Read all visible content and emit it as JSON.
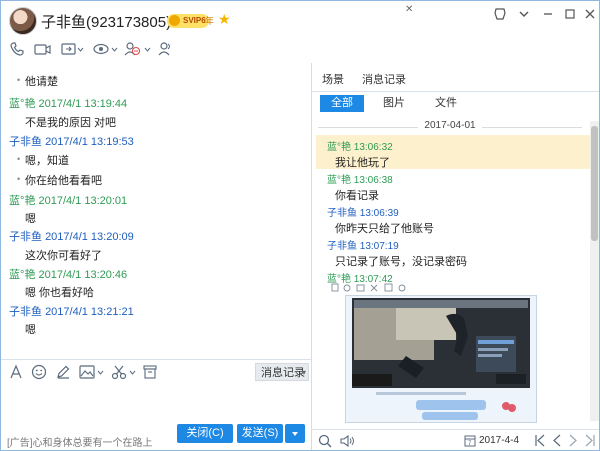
{
  "window": {
    "title": "子非鱼(923173805)",
    "badge": "SVIP6",
    "badge_suffix": "年"
  },
  "chat": {
    "messages": [
      {
        "type": "text",
        "text": "他请楚",
        "bullet": true
      },
      {
        "type": "head",
        "sender": "蓝°艳",
        "time": "2017/4/1 13:19:44",
        "color": "green"
      },
      {
        "type": "text",
        "text": "不是我的原因 对吧"
      },
      {
        "type": "head",
        "sender": "子非鱼",
        "time": "2017/4/1 13:19:53",
        "color": "blue"
      },
      {
        "type": "text",
        "text": "嗯，知道",
        "bullet": true
      },
      {
        "type": "text",
        "text": "你在给他看看吧",
        "bullet": true
      },
      {
        "type": "head",
        "sender": "蓝°艳",
        "time": "2017/4/1 13:20:01",
        "color": "green"
      },
      {
        "type": "text",
        "text": "嗯"
      },
      {
        "type": "head",
        "sender": "子非鱼",
        "time": "2017/4/1 13:20:09",
        "color": "blue"
      },
      {
        "type": "text",
        "text": "这次你可看好了"
      },
      {
        "type": "head",
        "sender": "蓝°艳",
        "time": "2017/4/1 13:20:46",
        "color": "green"
      },
      {
        "type": "text",
        "text": "嗯 你也看好哈"
      },
      {
        "type": "head",
        "sender": "子非鱼",
        "time": "2017/4/1 13:21:21",
        "color": "blue"
      },
      {
        "type": "text",
        "text": "嗯"
      }
    ],
    "history_button": "消息记录",
    "ad_text": "[广告]心和身体总要有一个在路上",
    "close_button": "关闭(C)",
    "send_button": "发送(S)"
  },
  "panel": {
    "tabs": [
      "场景",
      "消息记录"
    ],
    "filters": [
      "全部",
      "图片",
      "文件"
    ],
    "date_separator": "2017-04-01",
    "records": [
      {
        "sender": "蓝°艳",
        "time": "13:06:32",
        "color": "green",
        "text": "我让他玩了"
      },
      {
        "sender": "蓝°艳",
        "time": "13:06:38",
        "color": "green",
        "text": "你看记录"
      },
      {
        "sender": "子非鱼",
        "time": "13:06:39",
        "color": "blue",
        "text": "你昨天只给了他账号"
      },
      {
        "sender": "子非鱼",
        "time": "13:07:19",
        "color": "blue",
        "text": "只记录了账号，没记录密码"
      },
      {
        "sender": "蓝°艳",
        "time": "13:07:42",
        "color": "green",
        "text": ""
      }
    ],
    "calendar_date": "2017-4-4"
  },
  "colors": {
    "accent": "#1e88e5",
    "green_sender": "#2e9b54",
    "blue_sender": "#1f5fbf",
    "highlight": "#fdf0cc"
  }
}
